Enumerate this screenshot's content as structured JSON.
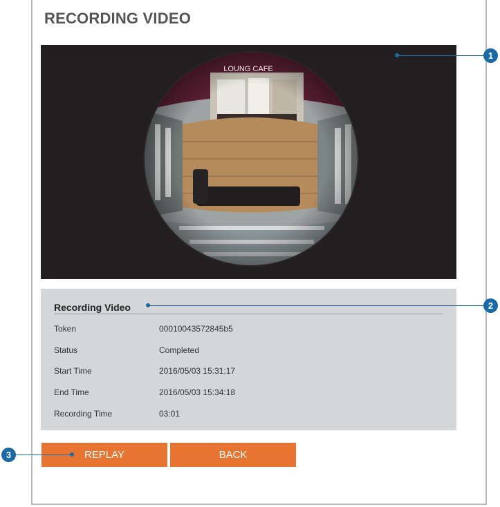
{
  "page": {
    "title": "RECORDING VIDEO"
  },
  "video": {
    "overlay_text": "LOUNG CAFE"
  },
  "info": {
    "title": "Recording Video",
    "rows": [
      {
        "label": "Token",
        "value": "00010043572845b5"
      },
      {
        "label": "Status",
        "value": "Completed"
      },
      {
        "label": "Start Time",
        "value": "2016/05/03 15:31:17"
      },
      {
        "label": "End Time",
        "value": "2016/05/03 15:34:18"
      },
      {
        "label": "Recording Time",
        "value": "03:01"
      }
    ]
  },
  "buttons": {
    "replay": "REPLAY",
    "back": "BACK"
  },
  "callouts": {
    "one": "1",
    "two": "2",
    "three": "3"
  },
  "colors": {
    "accent_orange": "#e87431",
    "callout_blue": "#1a6aa8",
    "video_bg": "#231f20",
    "panel_gray": "#d5d6d7"
  }
}
